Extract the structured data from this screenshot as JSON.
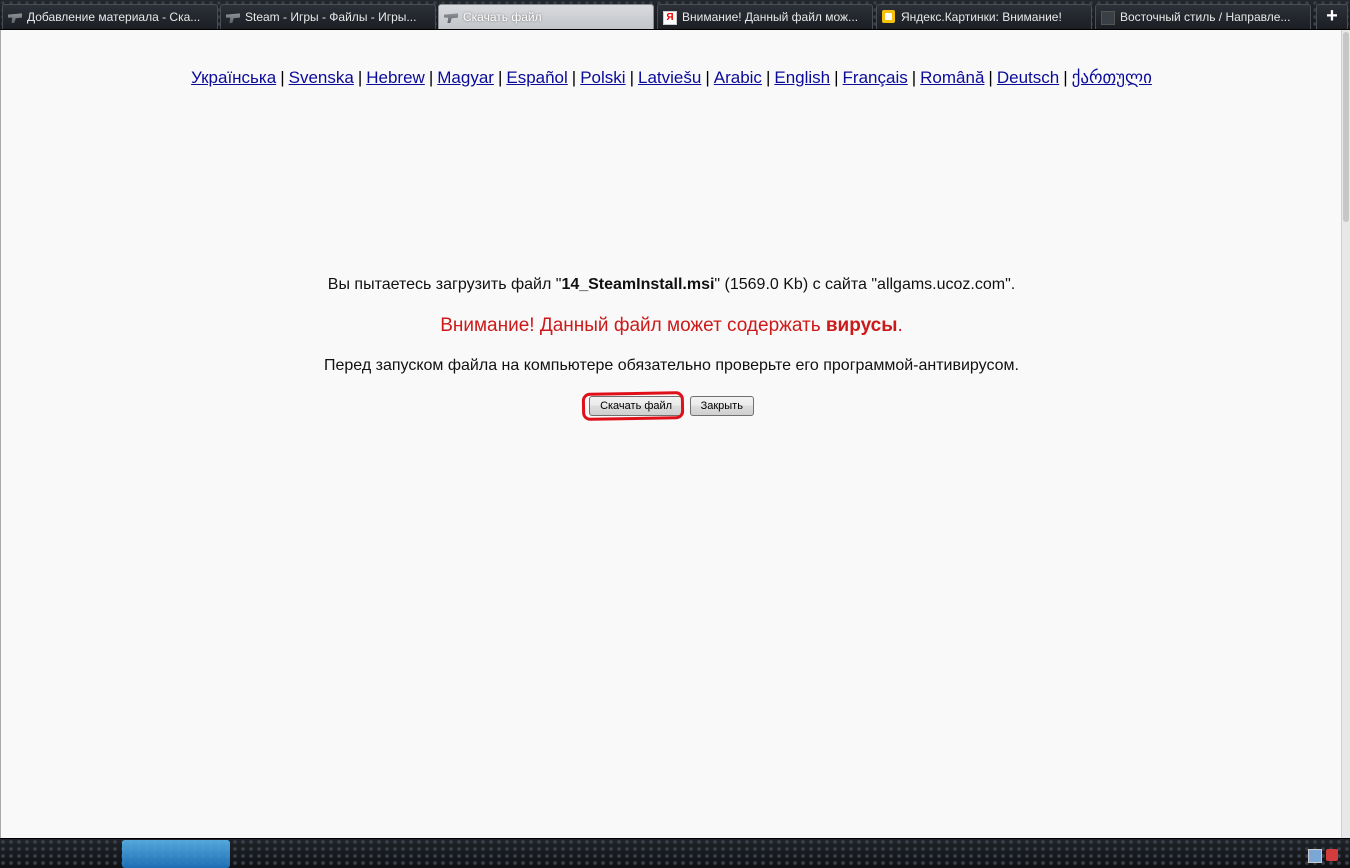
{
  "tabs": [
    {
      "label": "Добавление материала - Ска...",
      "icon": "gun-icon",
      "active": false
    },
    {
      "label": "Steam - Игры - Файлы - Игры...",
      "icon": "gun-icon",
      "active": false
    },
    {
      "label": "Скачать файл",
      "icon": "gun-icon",
      "active": true
    },
    {
      "label": "Внимание! Данный файл мож...",
      "icon": "yandex-icon",
      "active": false
    },
    {
      "label": "Яндекс.Картинки: Внимание!",
      "icon": "yandex-images-icon",
      "active": false
    },
    {
      "label": "Восточный стиль / Направле...",
      "icon": "page-icon",
      "active": false
    }
  ],
  "new_tab_label": "+",
  "yandex_glyph": "Я",
  "languages": [
    "Українська",
    "Svenska",
    "Hebrew",
    "Magyar",
    "Español",
    "Polski",
    "Latviešu",
    "Arabic",
    "English",
    "Français",
    "Română",
    "Deutsch",
    "ქართული"
  ],
  "separator": "|",
  "message": {
    "line1_pre": "Вы пытаетесь загрузить файл \"",
    "filename": "14_SteamInstall.msi",
    "line1_post": "\" (1569.0 Kb) с сайта \"allgams.ucoz.com\".",
    "warning_pre": "Внимание! Данный файл может содержать ",
    "warning_bold": "вирусы",
    "warning_post": ".",
    "line3": "Перед запуском файла на компьютере обязательно проверьте его программой-антивирусом."
  },
  "buttons": {
    "download": "Скачать файл",
    "close": "Закрыть"
  },
  "colors": {
    "link": "#0b0b99",
    "warning": "#cc1a1a",
    "highlight": "#e0101b",
    "page_bg": "#f9f9f9"
  }
}
